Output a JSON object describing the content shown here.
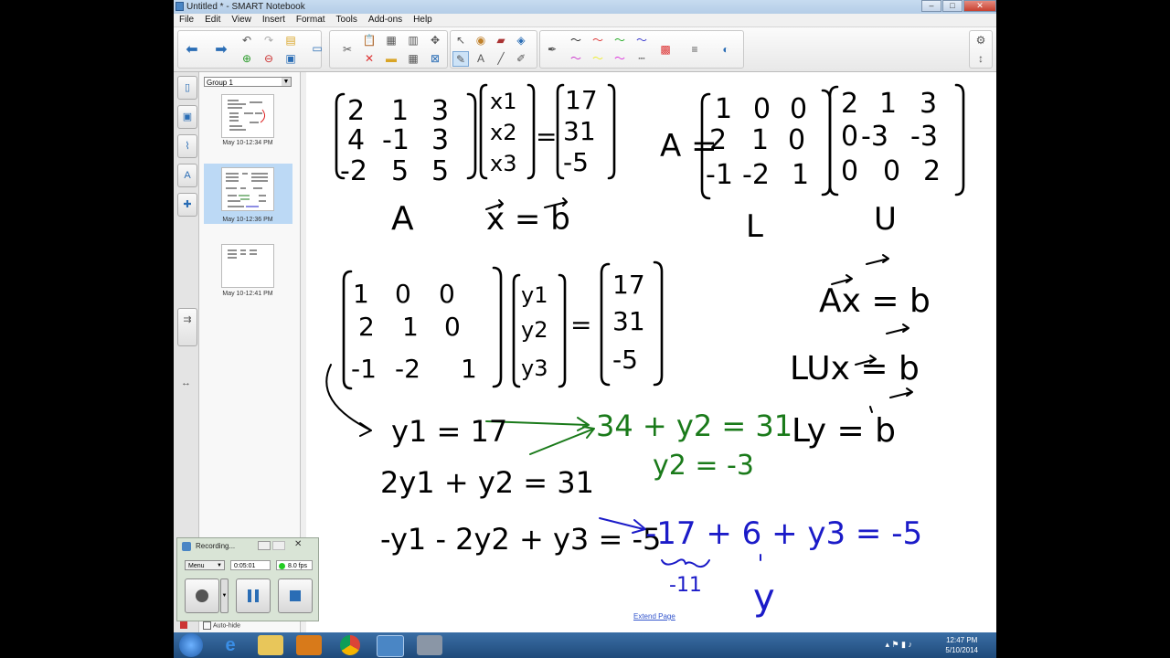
{
  "window": {
    "title": "Untitled * - SMART Notebook"
  },
  "window_buttons": {
    "minimize": "–",
    "maximize": "□",
    "close": "✕"
  },
  "menu": [
    "File",
    "Edit",
    "View",
    "Insert",
    "Format",
    "Tools",
    "Add-ons",
    "Help"
  ],
  "sorter": {
    "group": "Group 1",
    "pages": [
      {
        "label": "May 10-12:34 PM"
      },
      {
        "label": "May 10-12:36 PM"
      },
      {
        "label": "May 10-12:41 PM"
      }
    ]
  },
  "canvas": {
    "extend_link": "Extend Page",
    "ink": {
      "matrix_A": [
        [
          "2",
          "1",
          "3"
        ],
        [
          "4",
          "-1",
          "3"
        ],
        [
          "-2",
          "5",
          "5"
        ]
      ],
      "vector_x": [
        "x1",
        "x2",
        "x3"
      ],
      "vector_b": [
        "17",
        "31",
        "-5"
      ],
      "label_A": "A",
      "label_xb": "x = b",
      "lu_lhs": "A =",
      "matrix_L": [
        [
          "1",
          "0",
          "0"
        ],
        [
          "2",
          "1",
          "0"
        ],
        [
          "-1",
          "-2",
          "1"
        ]
      ],
      "matrix_U": [
        [
          "2",
          "1",
          "3"
        ],
        [
          "0",
          "-3",
          "-3"
        ],
        [
          "0",
          "0",
          "2"
        ]
      ],
      "label_L": "L",
      "label_U": "U",
      "vector_y": [
        "y1",
        "y2",
        "y3"
      ],
      "vector_b2": [
        "17",
        "31",
        "-5"
      ],
      "eq_Ax": "Ax = b",
      "eq_LUx": "LUx = b",
      "eq_Ly": "Ly = b",
      "eq1": "y1 = 17",
      "eq2": "2y1 + y2 = 31",
      "eq3": "-y1 - 2y2 + y3 = -5",
      "green1": "34 + y2 = 31",
      "green2": "y2 = -3",
      "blue1": "-17 + 6 + y3 = -5",
      "blue_under": "-11",
      "blue_y": "y"
    }
  },
  "recorder": {
    "title": "Recording...",
    "menu_label": "Menu",
    "time": "0:05:01",
    "fps": "8.0 fps",
    "autohide": "Auto-hide"
  },
  "clock": {
    "time": "12:47 PM",
    "date": "5/10/2014"
  },
  "colors": {
    "ink_black": "#000000",
    "ink_green": "#1a7a1a",
    "ink_blue": "#1b1bc8",
    "selected_thumb": "#bcd9f5"
  }
}
